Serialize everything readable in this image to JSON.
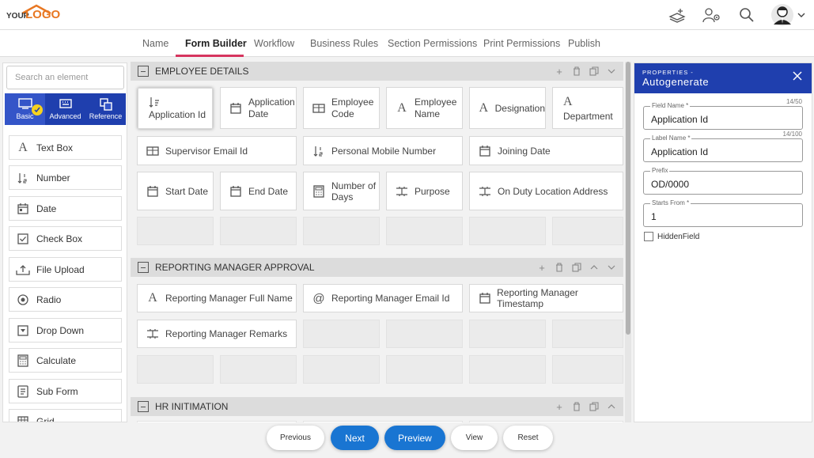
{
  "header": {
    "logo_your": "YOUR",
    "logo_text": "LOGO"
  },
  "tabs": [
    "Name",
    "Form Builder",
    "Workflow",
    "Business Rules",
    "Section Permissions",
    "Print Permissions",
    "Publish"
  ],
  "active_tab": "Form Builder",
  "left_panel": {
    "search_placeholder": "Search an element",
    "categories": [
      "Basic",
      "Advanced",
      "Reference"
    ],
    "active_category": "Basic",
    "elements": [
      {
        "label": "Text Box",
        "icon": "text-a-icon"
      },
      {
        "label": "Number",
        "icon": "number-sort-icon"
      },
      {
        "label": "Date",
        "icon": "calendar-icon"
      },
      {
        "label": "Check Box",
        "icon": "checkbox-icon"
      },
      {
        "label": "File Upload",
        "icon": "upload-icon"
      },
      {
        "label": "Radio",
        "icon": "radio-icon"
      },
      {
        "label": "Drop Down",
        "icon": "dropdown-icon"
      },
      {
        "label": "Calculate",
        "icon": "calculator-icon"
      },
      {
        "label": "Sub Form",
        "icon": "subform-icon"
      },
      {
        "label": "Grid",
        "icon": "grid-icon"
      }
    ]
  },
  "sections": [
    {
      "title": "EMPLOYEE DETAILS",
      "fields": [
        {
          "label": "Application Id",
          "icon": "number-sort-icon"
        },
        {
          "label": "Application Date",
          "icon": "calendar-icon"
        },
        {
          "label": "Employee Code",
          "icon": "table-icon"
        },
        {
          "label": "Employee Name",
          "icon": "text-a-icon"
        },
        {
          "label": "Designation",
          "icon": "text-a-icon"
        },
        {
          "label": "Department",
          "icon": "text-a-icon"
        },
        {
          "label": "Supervisor Email Id",
          "icon": "table-icon"
        },
        {
          "label": "Personal Mobile Number",
          "icon": "number-sort-icon"
        },
        {
          "label": "Joining Date",
          "icon": "calendar-icon"
        },
        {
          "label": "Start Date",
          "icon": "calendar-icon"
        },
        {
          "label": "End Date",
          "icon": "calendar-icon"
        },
        {
          "label": "Number of Days",
          "icon": "calculator-icon"
        },
        {
          "label": "Purpose",
          "icon": "textarea-icon"
        },
        {
          "label": "On Duty Location Address",
          "icon": "textarea-icon"
        }
      ]
    },
    {
      "title": "REPORTING MANAGER APPROVAL",
      "fields": [
        {
          "label": "Reporting Manager Full Name",
          "icon": "text-a-icon"
        },
        {
          "label": "Reporting Manager Email Id",
          "icon": "at-icon"
        },
        {
          "label": "Reporting Manager Timestamp",
          "icon": "calendar-icon"
        },
        {
          "label": "Reporting Manager Remarks",
          "icon": "textarea-icon"
        }
      ]
    },
    {
      "title": "HR INITIMATION",
      "fields": []
    }
  ],
  "properties": {
    "subtitle": "PROPERTIES -",
    "title": "Autogenerate",
    "field_name_label": "Field Name *",
    "field_name_value": "Application Id",
    "field_name_counter": "14/50",
    "label_name_label": "Label Name *",
    "label_name_value": "Application Id",
    "label_name_counter": "14/100",
    "prefix_label": "Prefix",
    "prefix_value": "OD/0000",
    "starts_from_label": "Starts From *",
    "starts_from_value": "1",
    "hidden_field_label": "HiddenField",
    "hidden_field_checked": false
  },
  "footer": {
    "previous": "Previous",
    "next": "Next",
    "preview": "Preview",
    "view": "View",
    "reset": "Reset"
  },
  "colors": {
    "accent_blue": "#1f3fae",
    "button_blue": "#1975d2",
    "tab_underline": "#d6345e",
    "logo_orange": "#e87722"
  }
}
